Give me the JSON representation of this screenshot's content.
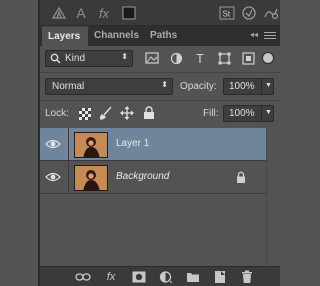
{
  "tabs": [
    {
      "label": "Layers",
      "active": true
    },
    {
      "label": "Channels",
      "active": false
    },
    {
      "label": "Paths",
      "active": false
    }
  ],
  "filter": {
    "label": "Kind"
  },
  "blend": {
    "mode": "Normal",
    "opacity_label": "Opacity:",
    "opacity_value": "100%"
  },
  "lock": {
    "label": "Lock:",
    "fill_label": "Fill:",
    "fill_value": "100%"
  },
  "layers": [
    {
      "name": "Layer 1",
      "selected": true,
      "visible": true,
      "locked": false
    },
    {
      "name": "Background",
      "selected": false,
      "visible": true,
      "locked": true
    }
  ],
  "top_toolbar": {
    "st_label": "St"
  },
  "bottom_bar": {
    "fx_label": "fx"
  },
  "colors": {
    "selected_row": "#6f859b",
    "panel_bg": "#535353",
    "thumb_bg": "#c58a55"
  }
}
